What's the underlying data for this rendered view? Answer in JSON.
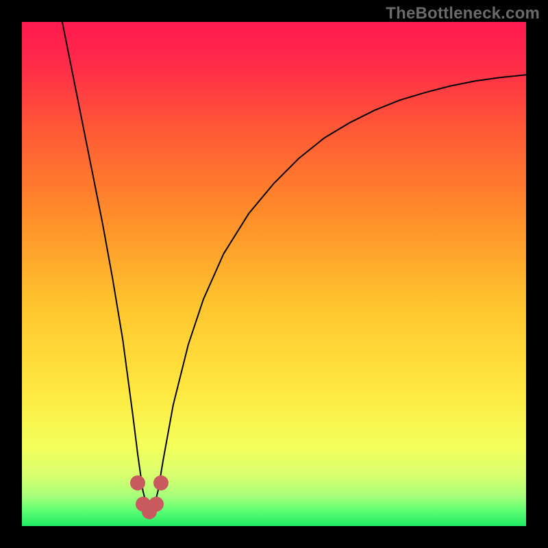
{
  "watermark": "TheBottleneck.com",
  "chart_data": {
    "type": "line",
    "title": "",
    "xlabel": "",
    "ylabel": "",
    "xlim": [
      0,
      100
    ],
    "ylim": [
      0,
      100
    ],
    "background_gradient": {
      "stops": [
        {
          "pct": 0,
          "color": "#ff1a4f"
        },
        {
          "pct": 8,
          "color": "#ff2a4a"
        },
        {
          "pct": 22,
          "color": "#ff5b35"
        },
        {
          "pct": 38,
          "color": "#ff8c2a"
        },
        {
          "pct": 55,
          "color": "#ffc22e"
        },
        {
          "pct": 72,
          "color": "#ffe63e"
        },
        {
          "pct": 84,
          "color": "#f5ff5a"
        },
        {
          "pct": 90,
          "color": "#d8ff70"
        },
        {
          "pct": 94,
          "color": "#a8ff7a"
        },
        {
          "pct": 97,
          "color": "#5cff74"
        },
        {
          "pct": 100,
          "color": "#1eea63"
        }
      ]
    },
    "series": [
      {
        "name": "bottleneck-curve",
        "stroke": "#000000",
        "stroke_width": 2,
        "x": [
          8,
          10,
          12,
          14,
          16,
          18,
          20,
          22,
          23,
          24,
          25,
          26,
          27,
          28,
          30,
          33,
          36,
          40,
          45,
          50,
          55,
          60,
          65,
          70,
          75,
          80,
          85,
          90,
          95,
          100
        ],
        "y": [
          100,
          90,
          80,
          70,
          60,
          49,
          37,
          22,
          14,
          7,
          3,
          3,
          7,
          13,
          24,
          36,
          45,
          54,
          62,
          68,
          73,
          77,
          80,
          82.5,
          84.5,
          86,
          87.3,
          88.3,
          89,
          89.5
        ]
      }
    ],
    "markers": {
      "color": "#c85a5f",
      "radius_px": 11,
      "points": [
        {
          "x": 23.0,
          "y": 8.5
        },
        {
          "x": 24.0,
          "y": 4.3
        },
        {
          "x": 25.3,
          "y": 2.8
        },
        {
          "x": 26.6,
          "y": 4.3
        },
        {
          "x": 27.6,
          "y": 8.5
        }
      ]
    }
  }
}
